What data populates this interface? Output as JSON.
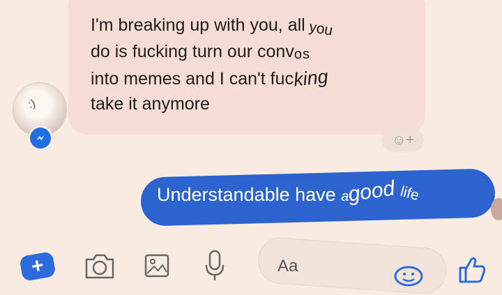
{
  "incoming": {
    "line1": "I'm breaking up with you, all",
    "line1_warp": "you",
    "line2": "do is fucking turn our conv",
    "line2_warp": "os",
    "line3": "into memes and I can't fuc",
    "line3_warp": "king",
    "line4": "take it anymore"
  },
  "reaction": {
    "label": "☺+"
  },
  "outgoing": {
    "part1": "Understandable have",
    "part2": "a",
    "part3": "good",
    "part4": "life"
  },
  "composer": {
    "placeholder": "Aa"
  },
  "toolbar": {
    "plus_label": "+"
  },
  "icons": [
    "messenger-icon",
    "camera-icon",
    "gallery-icon",
    "microphone-icon",
    "emoji-icon",
    "thumbs-up-icon"
  ],
  "colors": {
    "outgoing_bubble": "#2d63cf",
    "incoming_bubble": "#f5dcd4",
    "accent": "#2d6bdc"
  }
}
